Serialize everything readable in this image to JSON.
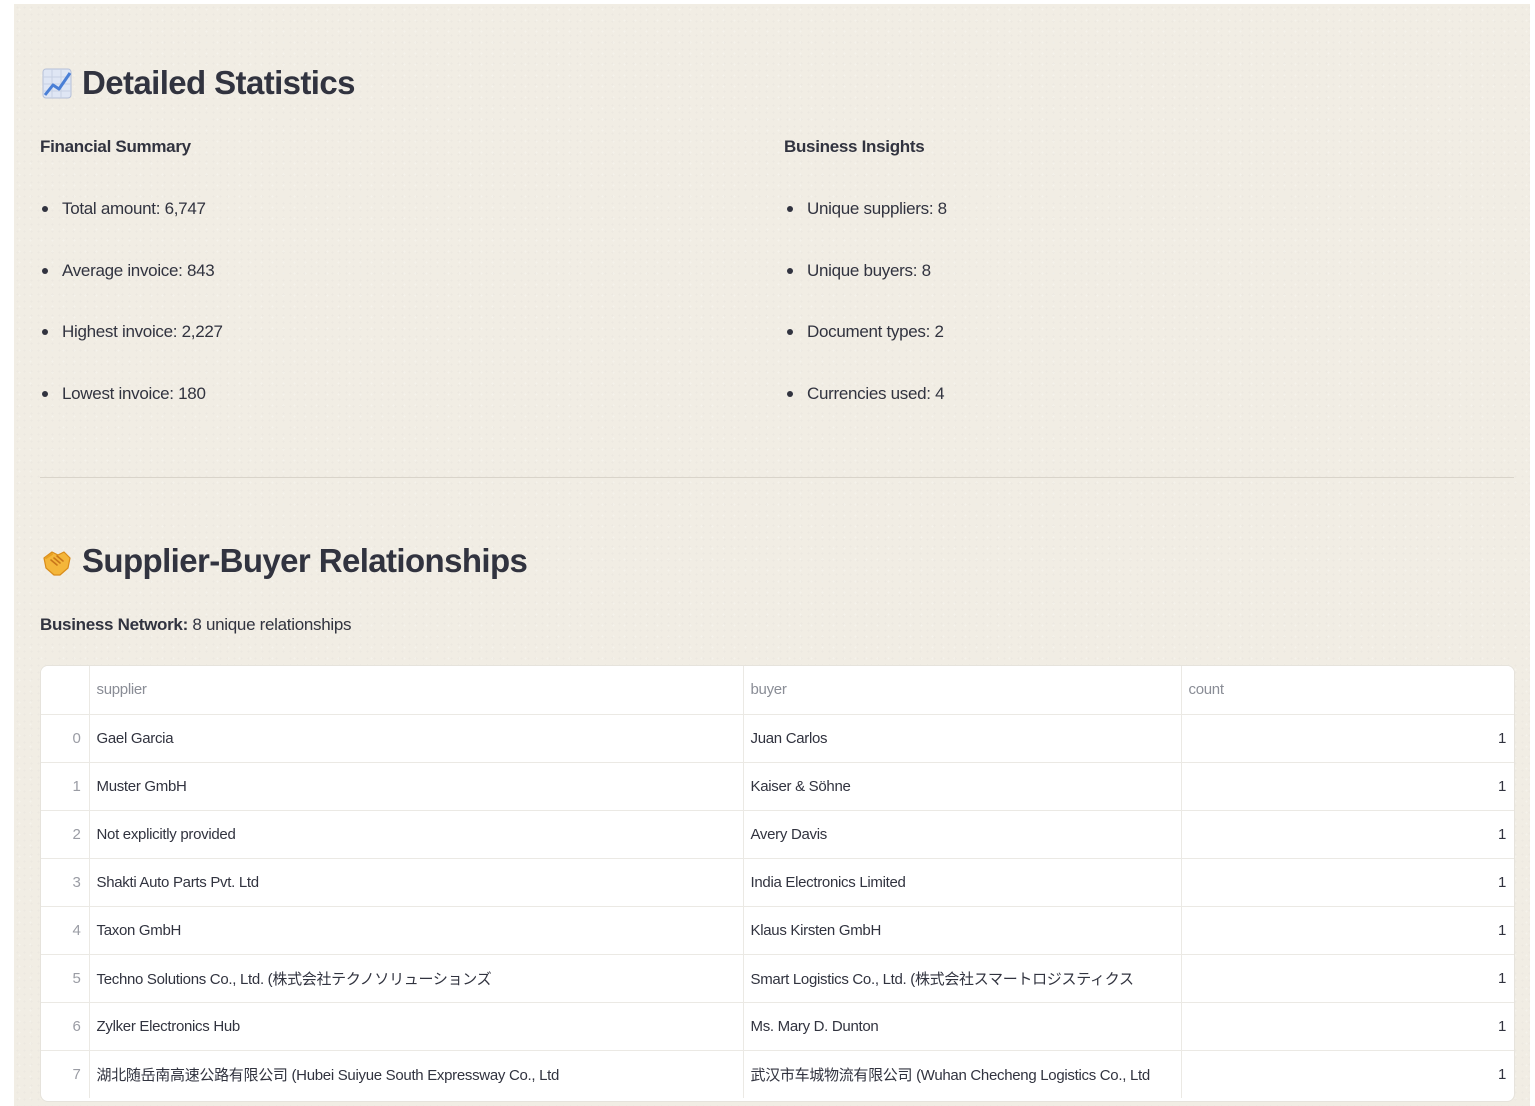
{
  "statistics": {
    "title": "Detailed Statistics",
    "title_icon": "chart-increasing-icon",
    "financial": {
      "heading": "Financial Summary",
      "items": [
        "Total amount: 6,747",
        "Average invoice: 843",
        "Highest invoice: 2,227",
        "Lowest invoice: 180"
      ]
    },
    "insights": {
      "heading": "Business Insights",
      "items": [
        "Unique suppliers: 8",
        "Unique buyers: 8",
        "Document types: 2",
        "Currencies used: 4"
      ]
    }
  },
  "relationships": {
    "title": "Supplier-Buyer Relationships",
    "title_icon": "handshake-icon",
    "network_label": "Business Network:",
    "network_value": "8 unique relationships",
    "table": {
      "columns": [
        "",
        "supplier",
        "buyer",
        "count"
      ],
      "rows": [
        [
          "0",
          "Gael Garcia",
          "Juan Carlos",
          "1"
        ],
        [
          "1",
          "Muster GmbH",
          "Kaiser & Söhne",
          "1"
        ],
        [
          "2",
          "Not explicitly provided",
          "Avery Davis",
          "1"
        ],
        [
          "3",
          "Shakti Auto Parts Pvt. Ltd",
          "India Electronics Limited",
          "1"
        ],
        [
          "4",
          "Taxon GmbH",
          "Klaus Kirsten GmbH",
          "1"
        ],
        [
          "5",
          "Techno Solutions Co., Ltd. (株式会社テクノソリューションズ",
          "Smart Logistics Co., Ltd. (株式会社スマートロジスティクス",
          "1"
        ],
        [
          "6",
          "Zylker Electronics Hub",
          "Ms. Mary D. Dunton",
          "1"
        ],
        [
          "7",
          "湖北随岳南高速公路有限公司 (Hubei Suiyue South Expressway Co., Ltd",
          "武汉市车城物流有限公司 (Wuhan Checheng Logistics Co., Ltd",
          "1"
        ]
      ]
    }
  },
  "colors": {
    "page_background": "#f1ede4",
    "text": "#31333f",
    "muted_text": "#8a8d96",
    "table_background": "#ffffff"
  }
}
